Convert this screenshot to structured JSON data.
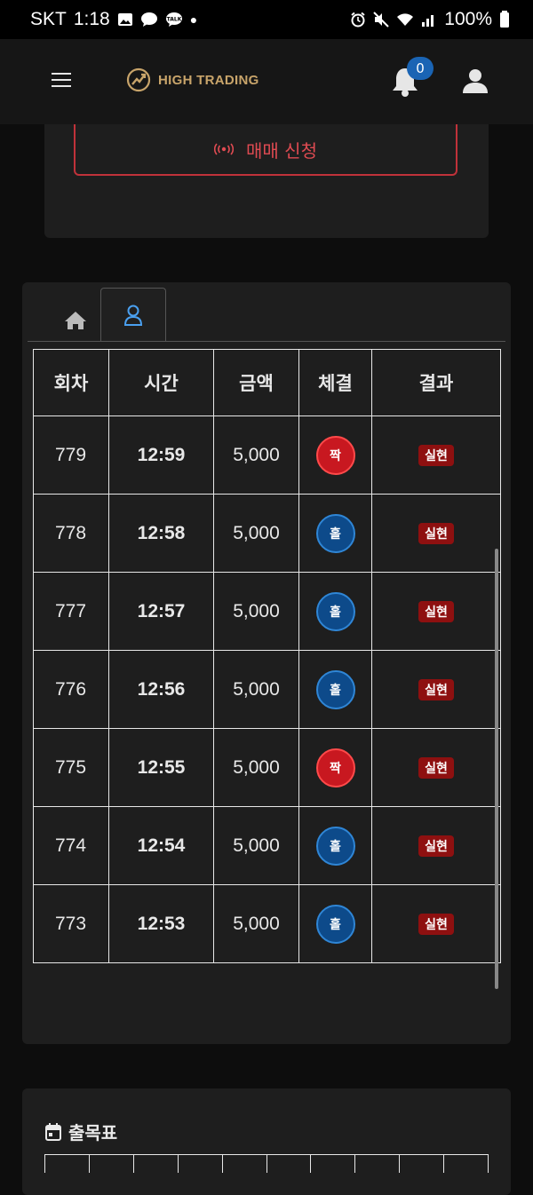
{
  "status_bar": {
    "carrier": "SKT",
    "time": "1:18",
    "battery": "100%",
    "notification_icons": [
      "gallery-icon",
      "chat-bubble-icon",
      "talk-icon",
      "dot-icon"
    ],
    "system_icons": [
      "alarm-icon",
      "mute-icon",
      "wifi-icon",
      "signal-icon",
      "battery-icon"
    ]
  },
  "header": {
    "logo_text": "HIGH TRADING",
    "notification_count": "0",
    "colors": {
      "logo": "#c8a46a",
      "badge": "#1a64b4"
    }
  },
  "trade": {
    "button_label": "매매 신청",
    "color": "#e04b52"
  },
  "tabs": [
    {
      "icon": "home-icon",
      "active": false
    },
    {
      "icon": "user-outline-icon",
      "active": true
    }
  ],
  "table": {
    "headers": [
      "회차",
      "시간",
      "금액",
      "체결",
      "결과"
    ],
    "rows": [
      {
        "round": "779",
        "time": "12:59",
        "amount": "5,000",
        "fill": "짝",
        "fill_color": "red",
        "result": "실현"
      },
      {
        "round": "778",
        "time": "12:58",
        "amount": "5,000",
        "fill": "홀",
        "fill_color": "blue",
        "result": "실현"
      },
      {
        "round": "777",
        "time": "12:57",
        "amount": "5,000",
        "fill": "홀",
        "fill_color": "blue",
        "result": "실현"
      },
      {
        "round": "776",
        "time": "12:56",
        "amount": "5,000",
        "fill": "홀",
        "fill_color": "blue",
        "result": "실현"
      },
      {
        "round": "775",
        "time": "12:55",
        "amount": "5,000",
        "fill": "짝",
        "fill_color": "red",
        "result": "실현"
      },
      {
        "round": "774",
        "time": "12:54",
        "amount": "5,000",
        "fill": "홀",
        "fill_color": "blue",
        "result": "실현"
      },
      {
        "round": "773",
        "time": "12:53",
        "amount": "5,000",
        "fill": "홀",
        "fill_color": "blue",
        "result": "실현"
      }
    ]
  },
  "attendance": {
    "title": "출목표"
  }
}
